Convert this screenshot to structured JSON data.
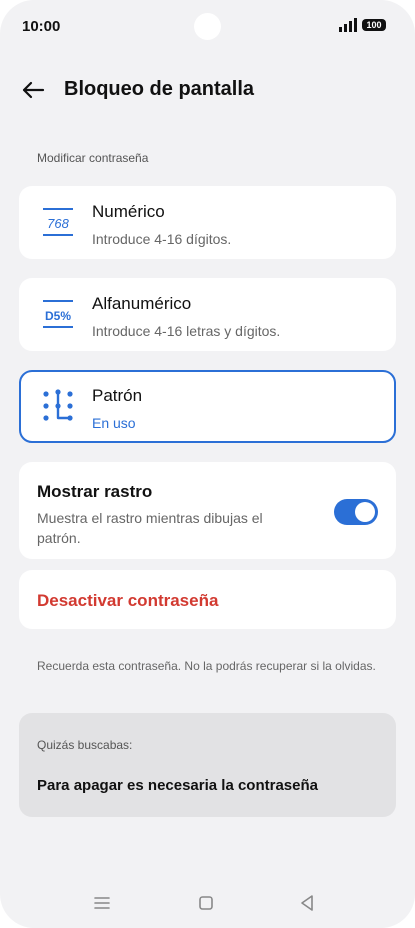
{
  "status_bar": {
    "time": "10:00",
    "battery": "100"
  },
  "header": {
    "title": "Bloqueo de pantalla"
  },
  "section_label": "Modificar contraseña",
  "options": [
    {
      "title": "Numérico",
      "subtitle": "Introduce 4-16 dígitos.",
      "icon": "numeric-768-icon",
      "icon_text": "768"
    },
    {
      "title": "Alfanumérico",
      "subtitle": "Introduce 4-16 letras y dígitos.",
      "icon": "alphanumeric-d5-icon",
      "icon_text": "D5%"
    },
    {
      "title": "Patrón",
      "subtitle": "En uso",
      "icon": "pattern-icon",
      "selected": true
    }
  ],
  "show_trace": {
    "title": "Mostrar rastro",
    "subtitle": "Muestra el rastro mientras dibujas el patrón.",
    "enabled": true
  },
  "disable_password": {
    "label": "Desactivar contraseña"
  },
  "note": "Recuerda esta contraseña. No la podrás recuperar si la olvidas.",
  "suggestion": {
    "label": "Quizás buscabas:",
    "link": "Para apagar es necesaria la contraseña"
  },
  "colors": {
    "accent": "#2b6fd6",
    "danger": "#d23a31",
    "background": "#f2f2f4"
  }
}
